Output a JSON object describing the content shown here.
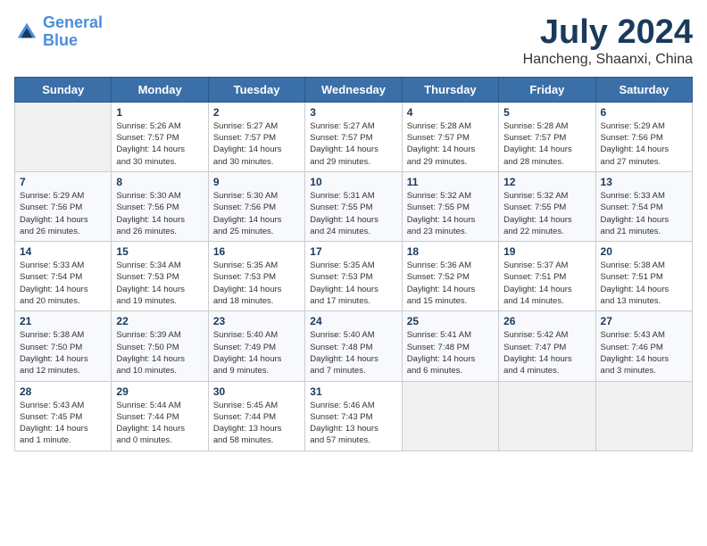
{
  "header": {
    "logo_line1": "General",
    "logo_line2": "Blue",
    "month_year": "July 2024",
    "location": "Hancheng, Shaanxi, China"
  },
  "weekdays": [
    "Sunday",
    "Monday",
    "Tuesday",
    "Wednesday",
    "Thursday",
    "Friday",
    "Saturday"
  ],
  "weeks": [
    [
      {
        "day": "",
        "info": ""
      },
      {
        "day": "1",
        "info": "Sunrise: 5:26 AM\nSunset: 7:57 PM\nDaylight: 14 hours\nand 30 minutes."
      },
      {
        "day": "2",
        "info": "Sunrise: 5:27 AM\nSunset: 7:57 PM\nDaylight: 14 hours\nand 30 minutes."
      },
      {
        "day": "3",
        "info": "Sunrise: 5:27 AM\nSunset: 7:57 PM\nDaylight: 14 hours\nand 29 minutes."
      },
      {
        "day": "4",
        "info": "Sunrise: 5:28 AM\nSunset: 7:57 PM\nDaylight: 14 hours\nand 29 minutes."
      },
      {
        "day": "5",
        "info": "Sunrise: 5:28 AM\nSunset: 7:57 PM\nDaylight: 14 hours\nand 28 minutes."
      },
      {
        "day": "6",
        "info": "Sunrise: 5:29 AM\nSunset: 7:56 PM\nDaylight: 14 hours\nand 27 minutes."
      }
    ],
    [
      {
        "day": "7",
        "info": "Sunrise: 5:29 AM\nSunset: 7:56 PM\nDaylight: 14 hours\nand 26 minutes."
      },
      {
        "day": "8",
        "info": "Sunrise: 5:30 AM\nSunset: 7:56 PM\nDaylight: 14 hours\nand 26 minutes."
      },
      {
        "day": "9",
        "info": "Sunrise: 5:30 AM\nSunset: 7:56 PM\nDaylight: 14 hours\nand 25 minutes."
      },
      {
        "day": "10",
        "info": "Sunrise: 5:31 AM\nSunset: 7:55 PM\nDaylight: 14 hours\nand 24 minutes."
      },
      {
        "day": "11",
        "info": "Sunrise: 5:32 AM\nSunset: 7:55 PM\nDaylight: 14 hours\nand 23 minutes."
      },
      {
        "day": "12",
        "info": "Sunrise: 5:32 AM\nSunset: 7:55 PM\nDaylight: 14 hours\nand 22 minutes."
      },
      {
        "day": "13",
        "info": "Sunrise: 5:33 AM\nSunset: 7:54 PM\nDaylight: 14 hours\nand 21 minutes."
      }
    ],
    [
      {
        "day": "14",
        "info": "Sunrise: 5:33 AM\nSunset: 7:54 PM\nDaylight: 14 hours\nand 20 minutes."
      },
      {
        "day": "15",
        "info": "Sunrise: 5:34 AM\nSunset: 7:53 PM\nDaylight: 14 hours\nand 19 minutes."
      },
      {
        "day": "16",
        "info": "Sunrise: 5:35 AM\nSunset: 7:53 PM\nDaylight: 14 hours\nand 18 minutes."
      },
      {
        "day": "17",
        "info": "Sunrise: 5:35 AM\nSunset: 7:53 PM\nDaylight: 14 hours\nand 17 minutes."
      },
      {
        "day": "18",
        "info": "Sunrise: 5:36 AM\nSunset: 7:52 PM\nDaylight: 14 hours\nand 15 minutes."
      },
      {
        "day": "19",
        "info": "Sunrise: 5:37 AM\nSunset: 7:51 PM\nDaylight: 14 hours\nand 14 minutes."
      },
      {
        "day": "20",
        "info": "Sunrise: 5:38 AM\nSunset: 7:51 PM\nDaylight: 14 hours\nand 13 minutes."
      }
    ],
    [
      {
        "day": "21",
        "info": "Sunrise: 5:38 AM\nSunset: 7:50 PM\nDaylight: 14 hours\nand 12 minutes."
      },
      {
        "day": "22",
        "info": "Sunrise: 5:39 AM\nSunset: 7:50 PM\nDaylight: 14 hours\nand 10 minutes."
      },
      {
        "day": "23",
        "info": "Sunrise: 5:40 AM\nSunset: 7:49 PM\nDaylight: 14 hours\nand 9 minutes."
      },
      {
        "day": "24",
        "info": "Sunrise: 5:40 AM\nSunset: 7:48 PM\nDaylight: 14 hours\nand 7 minutes."
      },
      {
        "day": "25",
        "info": "Sunrise: 5:41 AM\nSunset: 7:48 PM\nDaylight: 14 hours\nand 6 minutes."
      },
      {
        "day": "26",
        "info": "Sunrise: 5:42 AM\nSunset: 7:47 PM\nDaylight: 14 hours\nand 4 minutes."
      },
      {
        "day": "27",
        "info": "Sunrise: 5:43 AM\nSunset: 7:46 PM\nDaylight: 14 hours\nand 3 minutes."
      }
    ],
    [
      {
        "day": "28",
        "info": "Sunrise: 5:43 AM\nSunset: 7:45 PM\nDaylight: 14 hours\nand 1 minute."
      },
      {
        "day": "29",
        "info": "Sunrise: 5:44 AM\nSunset: 7:44 PM\nDaylight: 14 hours\nand 0 minutes."
      },
      {
        "day": "30",
        "info": "Sunrise: 5:45 AM\nSunset: 7:44 PM\nDaylight: 13 hours\nand 58 minutes."
      },
      {
        "day": "31",
        "info": "Sunrise: 5:46 AM\nSunset: 7:43 PM\nDaylight: 13 hours\nand 57 minutes."
      },
      {
        "day": "",
        "info": ""
      },
      {
        "day": "",
        "info": ""
      },
      {
        "day": "",
        "info": ""
      }
    ]
  ]
}
